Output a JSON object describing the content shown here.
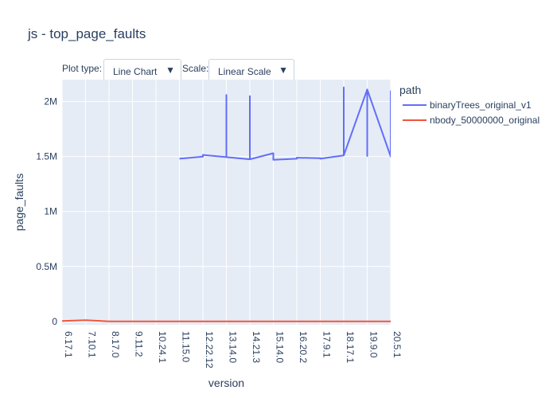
{
  "title": "js - top_page_faults",
  "controls": {
    "plot_type_label": "Plot type:",
    "plot_type_value": "Line Chart",
    "scale_label": "Scale:",
    "scale_value": "Linear Scale",
    "arrow_glyph": "▼"
  },
  "colors": {
    "plot_bg": "#e5ecf6",
    "grid": "#ffffff",
    "text": "#2a3f5f",
    "series1": "#636efa",
    "series2": "#ef553b"
  },
  "chart_data": {
    "type": "line",
    "xlabel": "version",
    "ylabel": "page_faults",
    "ylim": [
      -30000,
      2200000
    ],
    "yticks": [
      0,
      500000,
      1000000,
      1500000,
      2000000
    ],
    "ytick_labels": [
      "0",
      "0.5M",
      "1M",
      "1.5M",
      "2M"
    ],
    "categories": [
      "6.17.1",
      "7.10.1",
      "8.17.0",
      "9.11.2",
      "10.24.1",
      "11.15.0",
      "12.22.12",
      "13.14.0",
      "14.21.3",
      "15.14.0",
      "16.20.2",
      "17.9.1",
      "18.17.1",
      "19.9.0",
      "20.5.1"
    ],
    "legend": {
      "title": "path",
      "position": "top-right"
    },
    "grid": true,
    "series": [
      {
        "name": "binaryTrees_original_v1",
        "points": [
          [
            5,
            1480000
          ],
          [
            6,
            1500000
          ],
          [
            6,
            1515000
          ],
          [
            7,
            1495000
          ],
          [
            7,
            2060000
          ],
          [
            7,
            1495000
          ],
          [
            8,
            1475000
          ],
          [
            8,
            2050000
          ],
          [
            8,
            1475000
          ],
          [
            9,
            1530000
          ],
          [
            9,
            1470000
          ],
          [
            10,
            1480000
          ],
          [
            10,
            1490000
          ],
          [
            11,
            1485000
          ],
          [
            11,
            1480000
          ],
          [
            12,
            1510000
          ],
          [
            12,
            2130000
          ],
          [
            12,
            1510000
          ],
          [
            13,
            2110000
          ],
          [
            13,
            1505000
          ],
          [
            13,
            2110000
          ],
          [
            14,
            1500000
          ],
          [
            14,
            2100000
          ]
        ]
      },
      {
        "name": "nbody_50000000_original",
        "points": [
          [
            0,
            5000
          ],
          [
            1,
            12000
          ],
          [
            2,
            1000
          ],
          [
            3,
            1000
          ],
          [
            4,
            1000
          ],
          [
            5,
            1000
          ],
          [
            6,
            1000
          ],
          [
            7,
            1000
          ],
          [
            8,
            1000
          ],
          [
            9,
            1000
          ],
          [
            10,
            1000
          ],
          [
            11,
            1000
          ],
          [
            12,
            1000
          ],
          [
            13,
            1000
          ],
          [
            14,
            1000
          ]
        ]
      }
    ]
  }
}
